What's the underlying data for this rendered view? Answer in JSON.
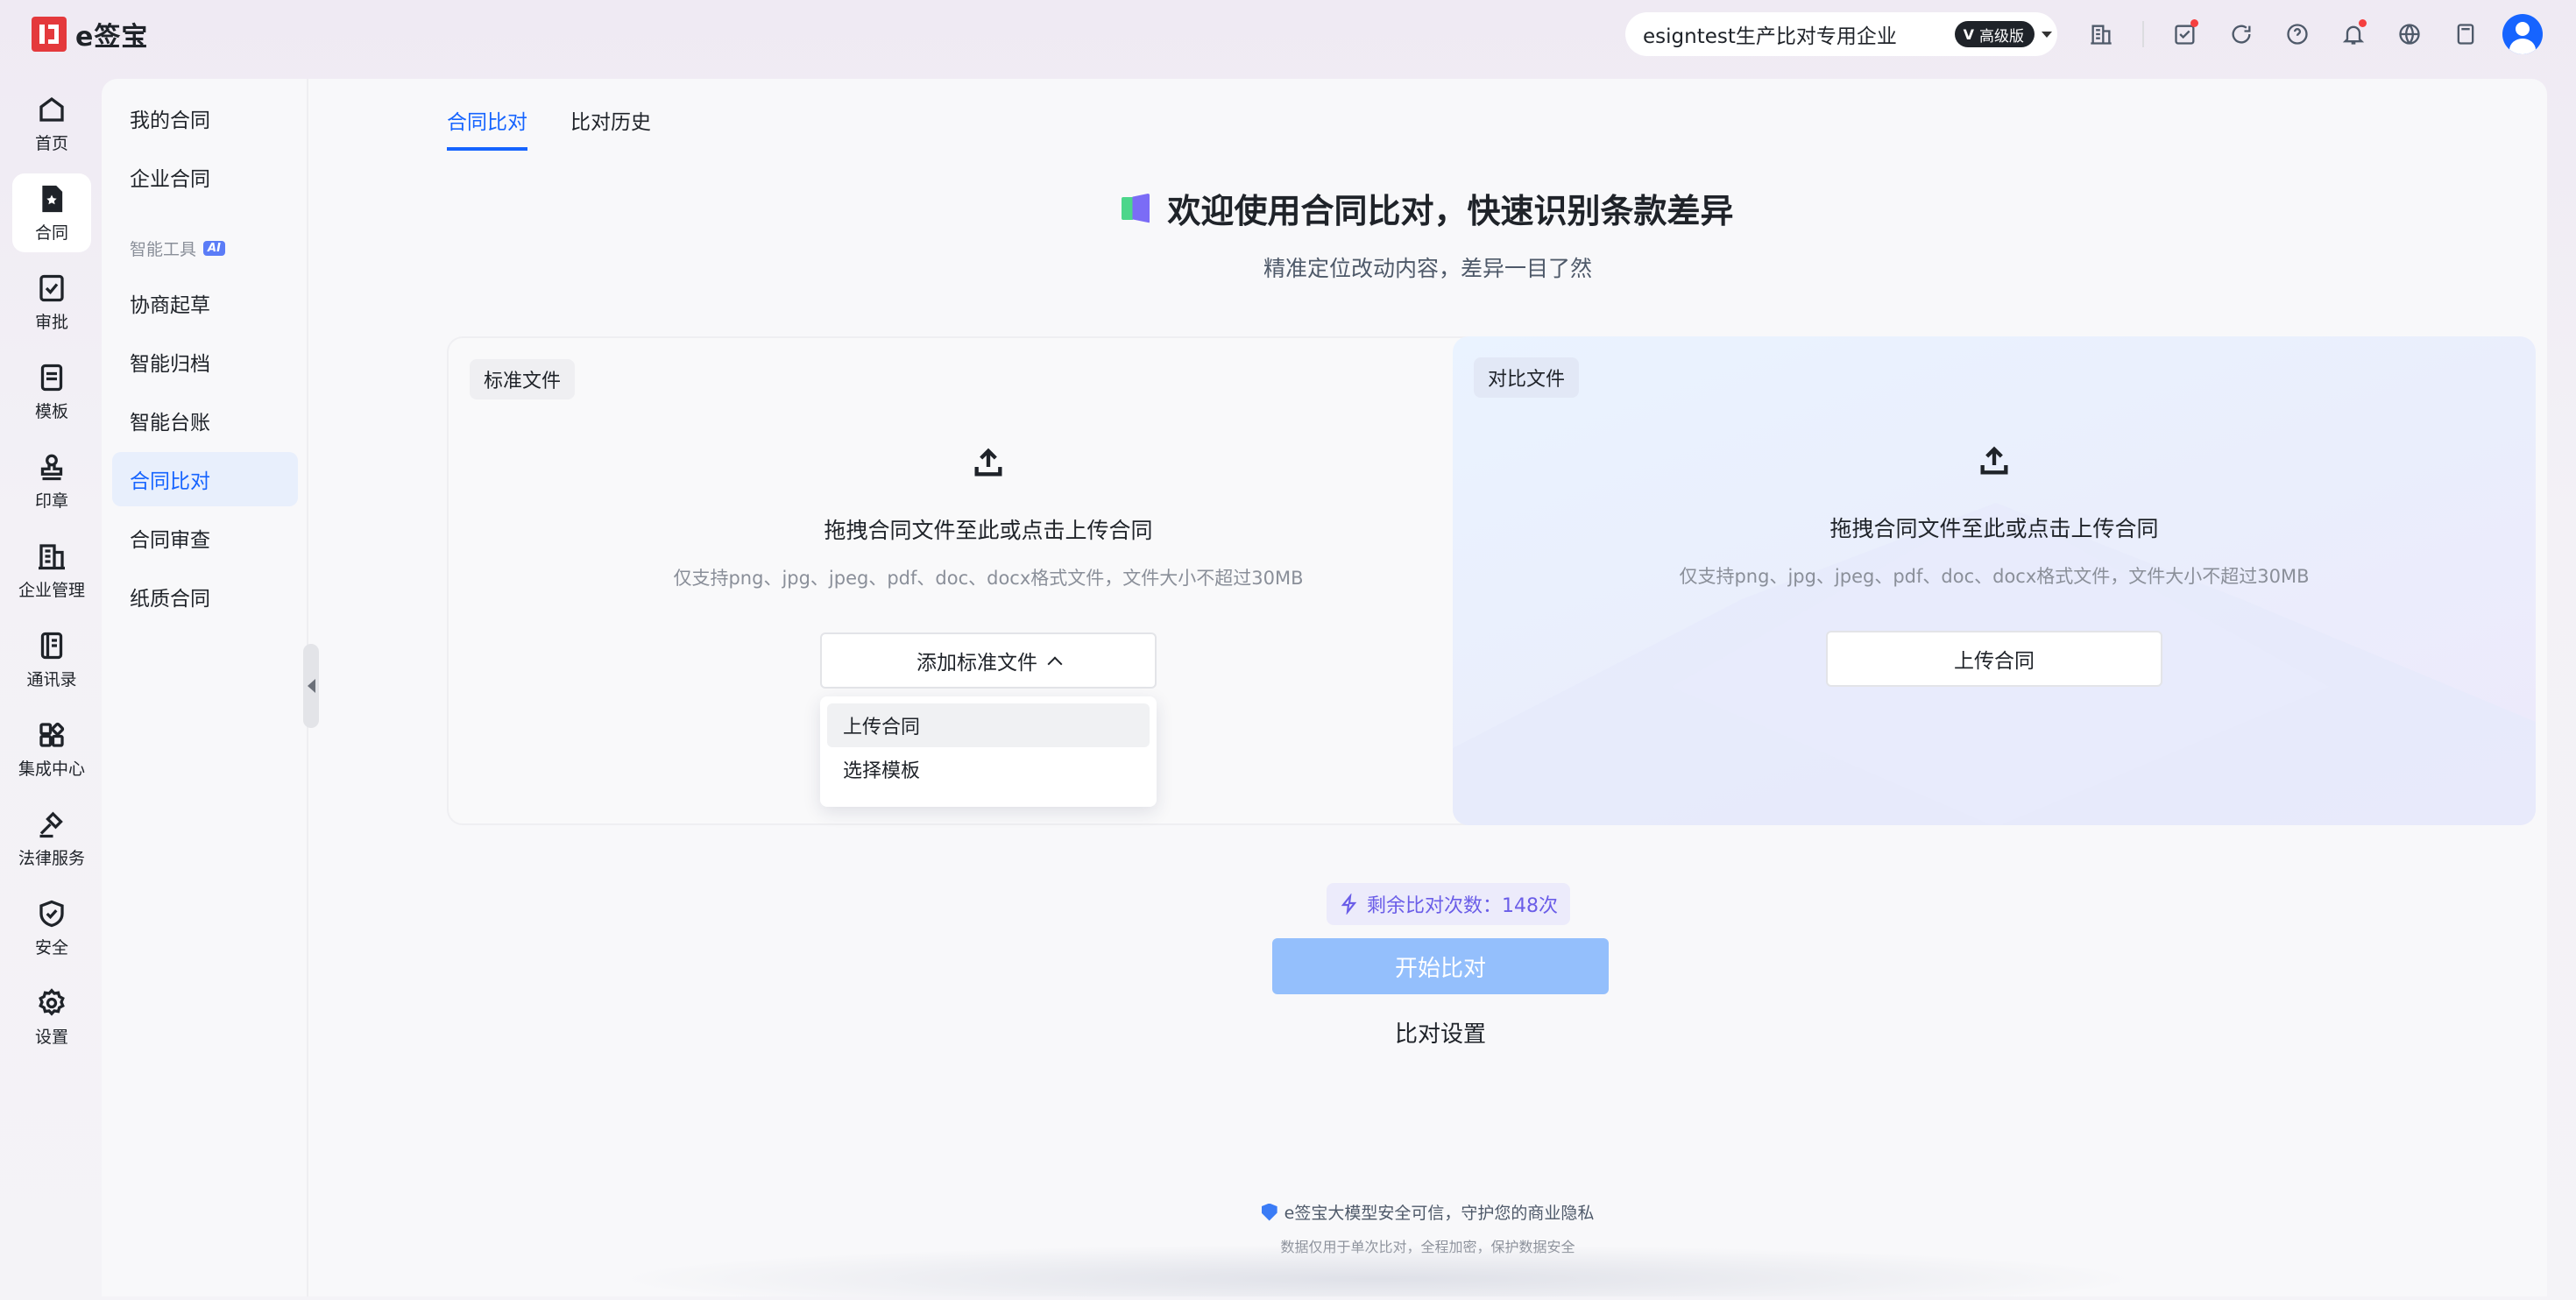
{
  "app": {
    "brand": "e签宝"
  },
  "header": {
    "org_name": "esigntest生产比对专用企业",
    "plan_label": "高级版",
    "plan_mark": "V"
  },
  "rail": {
    "items": [
      {
        "label": "首页",
        "icon": "home-icon"
      },
      {
        "label": "合同",
        "icon": "contract-icon",
        "active": true
      },
      {
        "label": "审批",
        "icon": "approval-icon"
      },
      {
        "label": "模板",
        "icon": "template-icon"
      },
      {
        "label": "印章",
        "icon": "seal-icon"
      },
      {
        "label": "企业管理",
        "icon": "building-icon"
      },
      {
        "label": "通讯录",
        "icon": "contacts-icon"
      },
      {
        "label": "集成中心",
        "icon": "integration-icon"
      },
      {
        "label": "法律服务",
        "icon": "gavel-icon"
      },
      {
        "label": "安全",
        "icon": "shield-icon"
      },
      {
        "label": "设置",
        "icon": "gear-icon"
      }
    ]
  },
  "subnav": {
    "my_contracts": "我的合同",
    "enterprise_contracts": "企业合同",
    "group_label": "智能工具",
    "ai_badge": "AI",
    "draft": "协商起草",
    "archive": "智能归档",
    "ledger": "智能台账",
    "compare": "合同比对",
    "review": "合同审查",
    "paper": "纸质合同"
  },
  "tabs": {
    "compare": "合同比对",
    "history": "比对历史"
  },
  "hero": {
    "title": "欢迎使用合同比对，快速识别条款差异",
    "subtitle": "精准定位改动内容，差异一目了然"
  },
  "standard_card": {
    "chip": "标准文件",
    "drop_title": "拖拽合同文件至此或点击上传合同",
    "drop_hint": "仅支持png、jpg、jpeg、pdf、doc、docx格式文件，文件大小不超过30MB",
    "button": "添加标准文件",
    "menu": [
      "上传合同",
      "选择模板"
    ]
  },
  "compare_card": {
    "chip": "对比文件",
    "drop_title": "拖拽合同文件至此或点击上传合同",
    "drop_hint": "仅支持png、jpg、jpeg、pdf、doc、docx格式文件，文件大小不超过30MB",
    "button": "上传合同"
  },
  "actions": {
    "remaining": "剩余比对次数：148次",
    "start": "开始比对",
    "settings": "比对设置"
  },
  "footer": {
    "line1": "e签宝大模型安全可信，守护您的商业隐私",
    "line2": "数据仅用于单次比对，全程加密，保护数据安全"
  },
  "colors": {
    "accent": "#1664ff",
    "brand_red": "#e4393c",
    "primary_disabled": "#94bffc",
    "ai_purple": "#6a5de8"
  }
}
